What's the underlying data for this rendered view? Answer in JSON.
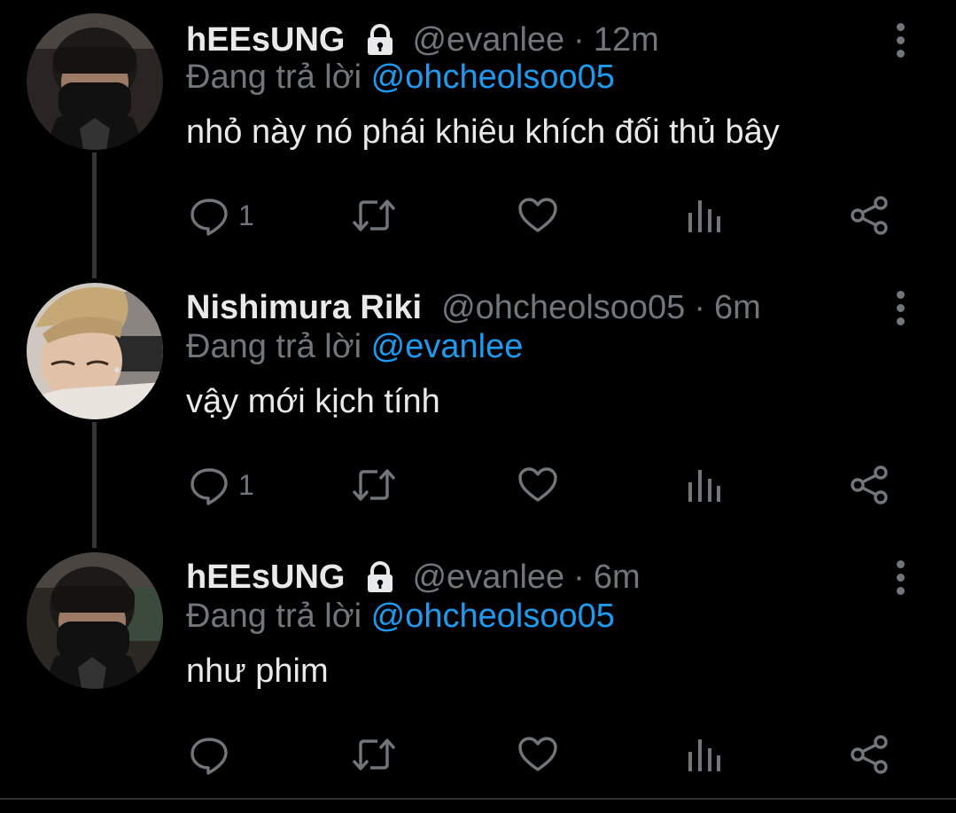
{
  "colors": {
    "background": "#000000",
    "text_primary": "#e7e9ea",
    "text_secondary": "#71767b",
    "mention": "#1d9bf0",
    "thread_line": "#333639"
  },
  "reply_prefix": "Đang trả lời",
  "tweets": [
    {
      "name": "hEEsUNG",
      "protected": true,
      "handle": "@evanlee",
      "dot": "·",
      "time": "12m",
      "reply_to": "@ohcheolsoo05",
      "text": "nhỏ này nó phái khiêu khích đối thủ bây",
      "reply_count": "1",
      "icons": [
        "reply-icon",
        "retweet-icon",
        "like-icon",
        "analytics-icon",
        "share-icon",
        "more-icon",
        "lock-icon"
      ]
    },
    {
      "name": "Nishimura Riki",
      "protected": false,
      "handle": "@ohcheolsoo05",
      "dot": "·",
      "time": "6m",
      "reply_to": "@evanlee",
      "text": "vậy mới kịch tính",
      "reply_count": "1",
      "icons": [
        "reply-icon",
        "retweet-icon",
        "like-icon",
        "analytics-icon",
        "share-icon",
        "more-icon"
      ]
    },
    {
      "name": "hEEsUNG",
      "protected": true,
      "handle": "@evanlee",
      "dot": "·",
      "time": "6m",
      "reply_to": "@ohcheolsoo05",
      "text": "như phim",
      "reply_count": "",
      "icons": [
        "reply-icon",
        "retweet-icon",
        "like-icon",
        "analytics-icon",
        "share-icon",
        "more-icon",
        "lock-icon"
      ]
    }
  ]
}
